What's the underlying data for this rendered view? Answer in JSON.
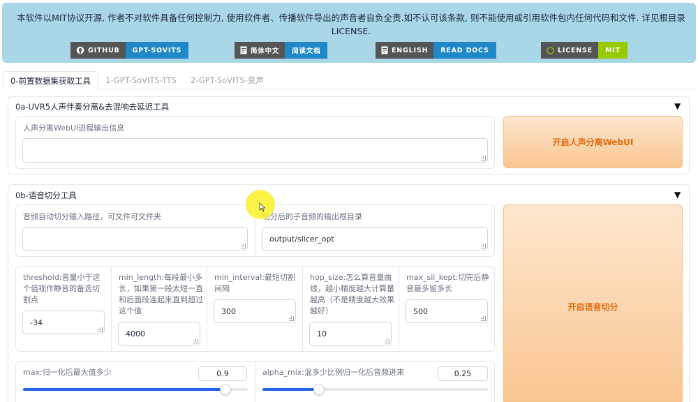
{
  "banner": {
    "text_line1": "本软件以MIT协议开源, 作者不对软件具备任何控制力, 使用软件者、传播软件导出的声音者自负全责.如不认可该条款, 则不能使用或引用软件包内任何代码和文件. 详见根目录",
    "text_line2": "LICENSE.",
    "badges": [
      {
        "left": "GITHUB",
        "right": "GPT-SOVITS",
        "color": "#1e88c8"
      },
      {
        "left": "简体中文",
        "right": "阅读文档",
        "color": "#1e88c8"
      },
      {
        "left": "ENGLISH",
        "right": "READ DOCS",
        "color": "#1e88c8"
      },
      {
        "left": "LICENSE",
        "right": "MIT",
        "color": "#97ca00"
      }
    ]
  },
  "tabs": [
    "0-前置数据集获取工具",
    "1-GPT-SoVITS-TTS",
    "2-GPT-SoVITS-变声"
  ],
  "uvr": {
    "title": "0a-UVR5人声伴奏分离&去混响去延迟工具",
    "caret": "▼",
    "output_label": "人声分离WebUI进程输出信息",
    "output_value": "",
    "button": "开启人声分离WebUI"
  },
  "slicer": {
    "title": "0b-语音切分工具",
    "caret": "▼",
    "input_path_label": "音频自动切分输入路径，可文件可文件夹",
    "input_path_value": "",
    "output_dir_label": "切分后的子音频的输出根目录",
    "output_dir_value": "output/slicer_opt",
    "threshold_label": "threshold:音量小于这个值视作静音的备选切割点",
    "threshold_value": "-34",
    "min_length_label": "min_length:每段最小多长，如果第一段太短一直和后面段连起来直到超过这个值",
    "min_length_value": "4000",
    "min_interval_label": "min_interval:最短切割间隔",
    "min_interval_value": "300",
    "hop_size_label": "hop_size:怎么算音量曲线，越小精度越大计算量越高（不是精度越大效果越好）",
    "hop_size_value": "10",
    "max_sil_label": "max_sil_kept:切完后静音最多留多长",
    "max_sil_value": "500",
    "max_label": "max:归一化后最大值多少",
    "max_value": "0.9",
    "max_fraction": 0.9,
    "alpha_label": "alpha_mix:混多少比例归一化后音频进来",
    "alpha_value": "0.25",
    "alpha_fraction": 0.25,
    "button": "开启语音切分"
  }
}
